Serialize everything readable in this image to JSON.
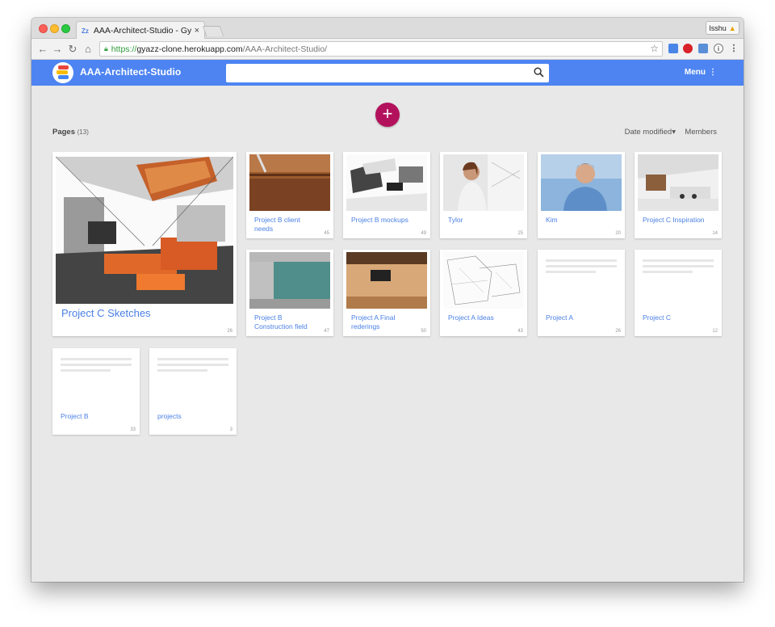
{
  "browser": {
    "tab_title": "AAA-Architect-Studio - Gyazz",
    "tab_favicon": "Zz",
    "tab_close": "×",
    "profile_name": "Isshu",
    "url_scheme": "https://",
    "url_host": "gyazz-clone.herokuapp.com",
    "url_path": "/AAA-Architect-Studio/",
    "nav_back": "←",
    "nav_forward": "→",
    "nav_reload": "↻",
    "nav_home": "⌂",
    "bookmark_star": "☆"
  },
  "app": {
    "title": "AAA-Architect-Studio",
    "brand_color": "#4d84f2",
    "accent_color": "#b3115c",
    "search_placeholder": "",
    "menu_label": "Menu",
    "menu_dots": "⋮",
    "add_button": "+"
  },
  "list": {
    "pages_label": "Pages",
    "pages_count": "(13)",
    "sort_label": "Date modified",
    "sort_caret": "▾",
    "members_label": "Members"
  },
  "cards": [
    {
      "name": "Project C Sketches",
      "count": "26"
    },
    {
      "name": "Project B client needs",
      "count": "45"
    },
    {
      "name": "Project B mockups",
      "count": "49"
    },
    {
      "name": "Tylor",
      "count": "25"
    },
    {
      "name": "Kim",
      "count": "20"
    },
    {
      "name": "Project C Inspiration",
      "count": "14"
    },
    {
      "name": "Project B Construction field",
      "count": "47"
    },
    {
      "name": "Project A Final rederings",
      "count": "50"
    },
    {
      "name": "Project A Ideas",
      "count": "43"
    },
    {
      "name": "Project A",
      "count": "26"
    },
    {
      "name": "Project C",
      "count": "12"
    },
    {
      "name": "Project B",
      "count": "33"
    },
    {
      "name": "projects",
      "count": "3"
    }
  ]
}
